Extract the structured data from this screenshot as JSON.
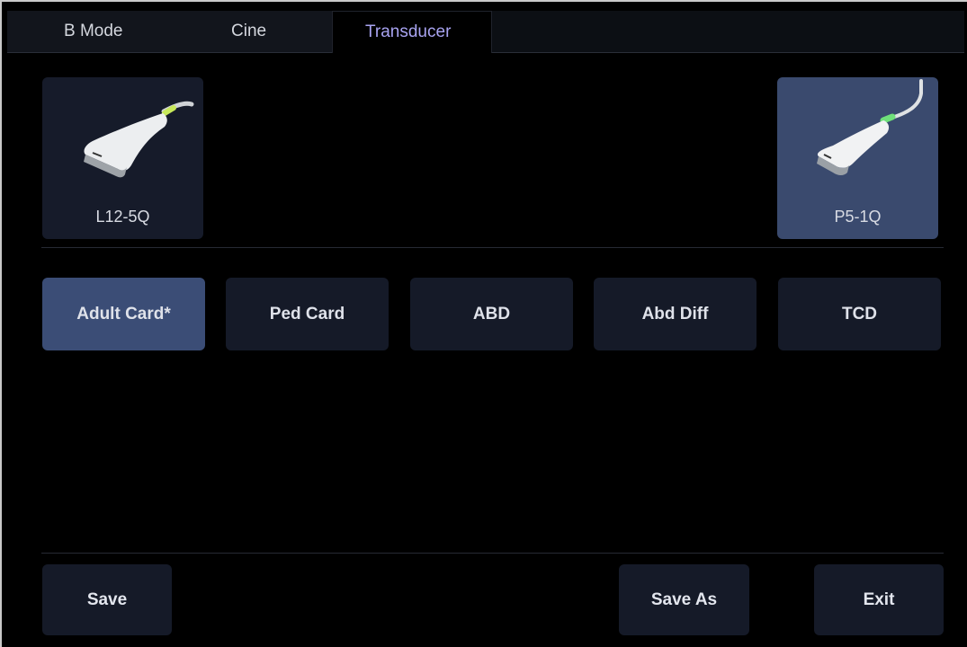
{
  "tabs": [
    {
      "label": "B Mode",
      "active": false
    },
    {
      "label": "Cine",
      "active": false
    },
    {
      "label": "Transducer",
      "active": true
    }
  ],
  "transducers": [
    {
      "label": "L12-5Q",
      "selected": false,
      "icon": "linear-probe-icon"
    },
    {
      "label": "P5-1Q",
      "selected": true,
      "icon": "phased-probe-icon"
    }
  ],
  "presets": [
    {
      "label": "Adult Card*",
      "selected": true
    },
    {
      "label": "Ped Card",
      "selected": false
    },
    {
      "label": "ABD",
      "selected": false
    },
    {
      "label": "Abd Diff",
      "selected": false
    },
    {
      "label": "TCD",
      "selected": false
    }
  ],
  "actions": {
    "save": "Save",
    "save_as": "Save As",
    "exit": "Exit"
  },
  "colors": {
    "active_tab_text": "#a9a4f2",
    "selected_bg": "#3b4d76",
    "button_bg": "#151a28",
    "probe_accent_green": "#6fe07a"
  }
}
